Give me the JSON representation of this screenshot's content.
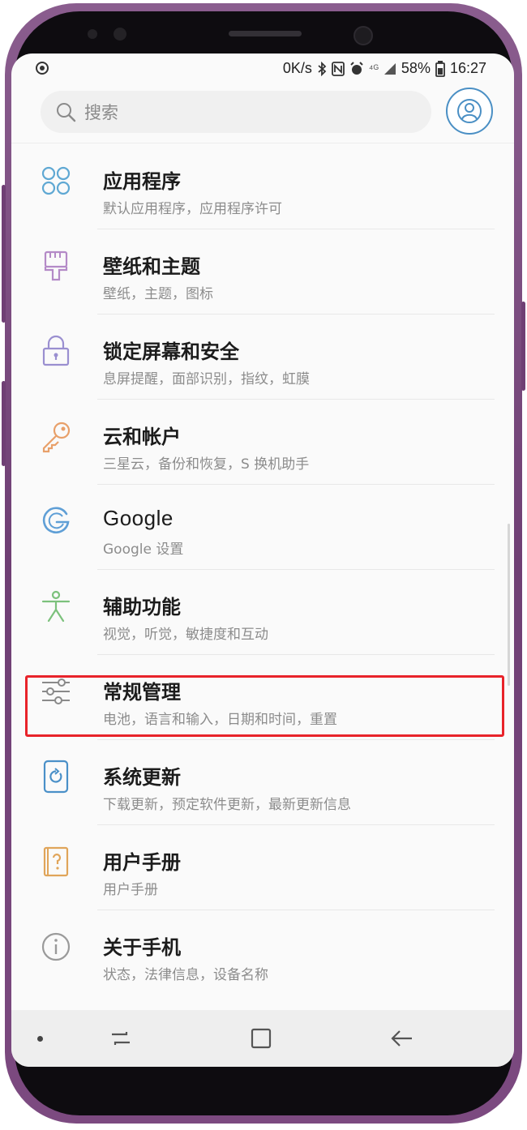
{
  "status_bar": {
    "net_speed": "0K/s",
    "battery_pct": "58%",
    "time": "16:27"
  },
  "search": {
    "placeholder": "搜索"
  },
  "settings_items": [
    {
      "title": "应用程序",
      "subtitle": "默认应用程序，应用程序许可",
      "icon": "apps-grid-icon",
      "color": "#5fa8d3"
    },
    {
      "title": "壁纸和主题",
      "subtitle": "壁纸，主题，图标",
      "icon": "paintbrush-icon",
      "color": "#b48ac7"
    },
    {
      "title": "锁定屏幕和安全",
      "subtitle": "息屏提醒，面部识别，指纹，虹膜",
      "icon": "lock-icon",
      "color": "#9a8fd0"
    },
    {
      "title": "云和帐户",
      "subtitle": "三星云，备份和恢复，S 换机助手",
      "icon": "key-icon",
      "color": "#e8a06a"
    },
    {
      "title": "Google",
      "subtitle": "Google 设置",
      "icon": "google-g-icon",
      "color": "#5f9fd6"
    },
    {
      "title": "辅助功能",
      "subtitle": "视觉，听觉，敏捷度和互动",
      "icon": "accessibility-person-icon",
      "color": "#7cc17c"
    },
    {
      "title": "常规管理",
      "subtitle": "电池，语言和输入，日期和时间，重置",
      "icon": "sliders-icon",
      "color": "#8a8a8a"
    },
    {
      "title": "系统更新",
      "subtitle": "下载更新，预定软件更新，最新更新信息",
      "icon": "system-update-icon",
      "color": "#4a90c8"
    },
    {
      "title": "用户手册",
      "subtitle": "用户手册",
      "icon": "manual-question-icon",
      "color": "#e0a55a"
    },
    {
      "title": "关于手机",
      "subtitle": "状态，法律信息，设备名称",
      "icon": "info-icon",
      "color": "#9a9a9a"
    }
  ],
  "highlight": {
    "color": "#e8232a",
    "target": "常规管理"
  },
  "nav_bar": {
    "buttons": [
      "recent-apps-icon",
      "home-icon",
      "back-icon"
    ]
  }
}
